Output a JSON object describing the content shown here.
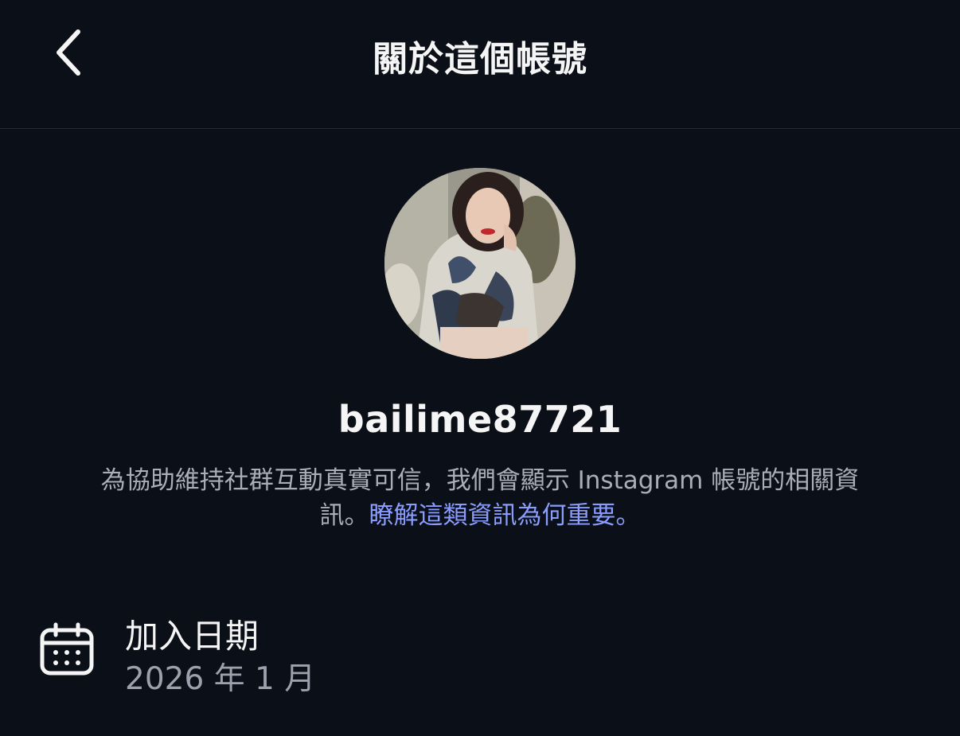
{
  "header": {
    "title": "關於這個帳號",
    "back_icon": "chevron-left-icon"
  },
  "profile": {
    "username": "bailime87721",
    "description_text": "為協助維持社群互動真實可信，我們會顯示 Instagram 帳號的相關資訊。",
    "description_link": "瞭解這類資訊為何重要。"
  },
  "details": {
    "join_date": {
      "icon": "calendar-icon",
      "label": "加入日期",
      "value": "2026 年 1 月"
    }
  },
  "colors": {
    "background": "#0b0f17",
    "text_primary": "#f5f5f5",
    "text_secondary": "#a9aeb8",
    "link": "#8a9dff",
    "divider": "#262a33"
  }
}
